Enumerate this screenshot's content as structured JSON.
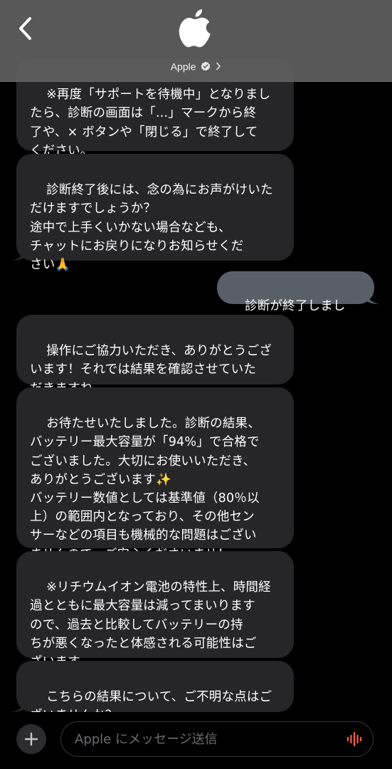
{
  "header": {
    "contact_name": "Apple",
    "logo_icon": "apple-logo-icon",
    "back_icon": "chevron-left-icon",
    "verified_icon": "verified-badge-icon"
  },
  "messages": [
    {
      "direction": "incoming",
      "text": "※再度「サポートを待機中」となりまし\nたら、診断の画面は「...」マークから終\n了や、× ボタンや「閉じる」で終了して\nください。"
    },
    {
      "direction": "incoming",
      "text": "診断終了後には、念の為にお声がけいた\nだけますでしょうか？\n途中で上手くいかない場合なども、\nチャットにお戻りになりお知らせくだ\nさい🙏"
    },
    {
      "direction": "outgoing",
      "text": "診断が終了しました。"
    },
    {
      "direction": "incoming",
      "text": "操作にご協力いただき、ありがとうござ\nいます！それでは結果を確認させていた\nだきますね。"
    },
    {
      "direction": "incoming",
      "text": "お待たせいたしました。診断の結果、\nバッテリー最大容量が「94%」で合格で\nございました。大切にお使いいただき、\nありがとうございます✨\nバッテリー数値としては基準値（80％以\n上）の範囲内となっており、その他セン\nサーなどの項目も機械的な問題はござい\nませんので、ご安心くださいませ！"
    },
    {
      "direction": "incoming",
      "text": "※リチウムイオン電池の特性上、時間経\n過とともに最大容量は減ってまいります\nので、過去と比較してバッテリーの持\nちが悪くなったと体感される可能性はご\nざいます。"
    },
    {
      "direction": "incoming",
      "text": "こちらの結果について、ご不明な点はご\nざいませんか？"
    }
  ],
  "composer": {
    "placeholder": "Apple にメッセージ送信",
    "plus_icon": "plus-icon",
    "mic_icon": "audio-waveform-icon"
  },
  "colors": {
    "incoming_bubble": "#262628",
    "outgoing_bubble": "#585f67",
    "header_bg": "#5f5f5f",
    "mic_accent": "#ff5a4e"
  }
}
